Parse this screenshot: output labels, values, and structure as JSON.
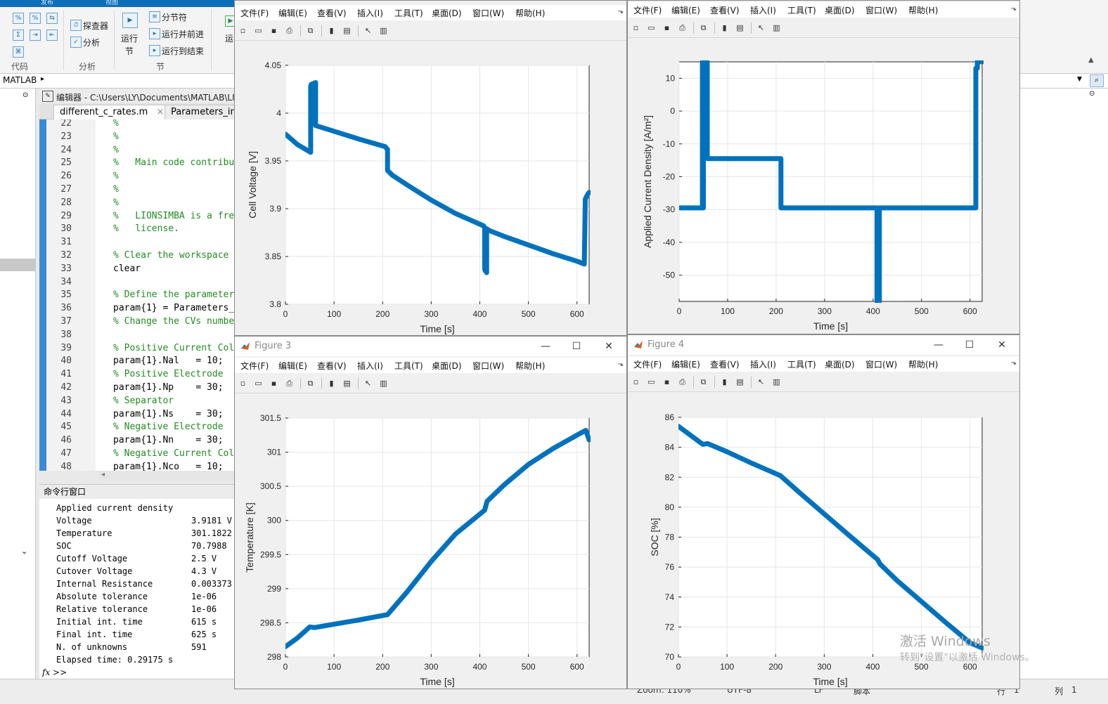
{
  "ribbon": {
    "tabs": [
      "发布",
      "视图"
    ],
    "buttons": {
      "explorer": "探查器",
      "analyze": "分析",
      "run_section_top": "运行",
      "run_section_bottom": "节",
      "section_break": "分节符",
      "run_and_advance": "运行并前进",
      "run_to_end": "运行到结束",
      "run_partial": "运"
    },
    "sections": {
      "code": "代码",
      "analyze": "分析",
      "section": "节"
    }
  },
  "address": {
    "path": "MATLAB"
  },
  "editor": {
    "title": "编辑器 - C:\\Users\\LY\\Documents\\MATLAB\\LI",
    "tabs": [
      {
        "label": "different_c_rates.m",
        "close": "×"
      },
      {
        "label": "Parameters_ini"
      }
    ],
    "lines": [
      {
        "n": "22",
        "t": "%",
        "type": "c"
      },
      {
        "n": "23",
        "t": "%",
        "type": "c"
      },
      {
        "n": "24",
        "t": "%",
        "type": "c"
      },
      {
        "n": "25",
        "t": "%   Main code contribu",
        "type": "c"
      },
      {
        "n": "26",
        "t": "%",
        "type": "c"
      },
      {
        "n": "27",
        "t": "%",
        "type": "c"
      },
      {
        "n": "28",
        "t": "%",
        "type": "c"
      },
      {
        "n": "29",
        "t": "%   LIONSIMBA is a fre",
        "type": "c"
      },
      {
        "n": "30",
        "t": "%   license.",
        "type": "c"
      },
      {
        "n": "31",
        "t": "",
        "type": "k"
      },
      {
        "n": "32",
        "t": "% Clear the workspace",
        "type": "c"
      },
      {
        "n": "33",
        "t": "clear",
        "type": "k"
      },
      {
        "n": "34",
        "t": "",
        "type": "k"
      },
      {
        "n": "35",
        "t": "% Define the parameter",
        "type": "c"
      },
      {
        "n": "36",
        "t": "param{1} = Parameters_",
        "type": "k"
      },
      {
        "n": "37",
        "t": "% Change the CVs numbe",
        "type": "c"
      },
      {
        "n": "38",
        "t": "",
        "type": "k"
      },
      {
        "n": "39",
        "t": "% Positive Current Col",
        "type": "c"
      },
      {
        "n": "40",
        "t": "param{1}.Nal   = 10;",
        "type": "k"
      },
      {
        "n": "41",
        "t": "% Positive Electrode",
        "type": "c"
      },
      {
        "n": "42",
        "t": "param{1}.Np    = 30;",
        "type": "k"
      },
      {
        "n": "43",
        "t": "% Separator",
        "type": "c"
      },
      {
        "n": "44",
        "t": "param{1}.Ns    = 30;",
        "type": "k"
      },
      {
        "n": "45",
        "t": "% Negative Electrode",
        "type": "c"
      },
      {
        "n": "46",
        "t": "param{1}.Nn    = 30;",
        "type": "k"
      },
      {
        "n": "47",
        "t": "% Negative Current Col",
        "type": "c"
      },
      {
        "n": "48",
        "t": "param{1}.Nco   = 10;",
        "type": "k"
      }
    ]
  },
  "command_window": {
    "title": "命令行窗口",
    "header": "Applied current density",
    "rows": [
      {
        "k": "Voltage",
        "v": "3.9181 V"
      },
      {
        "k": "Temperature",
        "v": "301.1822"
      },
      {
        "k": "SOC",
        "v": "70.7988"
      },
      {
        "k": "Cutoff Voltage",
        "v": "2.5 V"
      },
      {
        "k": "Cutover Voltage",
        "v": "4.3 V"
      },
      {
        "k": "Internal Resistance",
        "v": "0.003373"
      },
      {
        "k": "Absolute tolerance",
        "v": "1e-06"
      },
      {
        "k": "Relative tolerance",
        "v": "1e-06"
      },
      {
        "k": "Initial int. time",
        "v": "615 s"
      },
      {
        "k": "Final int. time",
        "v": "625 s"
      },
      {
        "k": "N. of unknowns",
        "v": "591"
      }
    ],
    "elapsed": "Elapsed time: 0.29175 s",
    "prompt": "fx >>"
  },
  "statusbar": {
    "zoom": "Zoom: 110%",
    "encoding": "UTF-8",
    "eol": "LF",
    "type": "脚本",
    "row_label": "行",
    "row": "1",
    "col_label": "列",
    "col": "1"
  },
  "figure_menu": [
    "文件(F)",
    "编辑(E)",
    "查看(V)",
    "插入(I)",
    "工具(T)",
    "桌面(D)",
    "窗口(W)",
    "帮助(H)"
  ],
  "window_buttons": {
    "minimize": "—",
    "maximize": "☐",
    "close": "✕"
  },
  "figures": [
    {
      "title": "",
      "has_titlebar": false
    },
    {
      "title": "",
      "has_titlebar": false
    },
    {
      "title": "Figure 3",
      "has_titlebar": true
    },
    {
      "title": "Figure 4",
      "has_titlebar": true
    }
  ],
  "watermark": {
    "line1": "激活 Windows",
    "line2": "转到\"设置\"以激活 Windows。"
  },
  "colors": {
    "line": "#0072bd",
    "matlab_blue": "#0d6fb8"
  },
  "chart_data": [
    {
      "type": "line",
      "xlabel": "Time [s]",
      "ylabel": "Cell Voltage [V]",
      "xlim": [
        0,
        625
      ],
      "ylim": [
        3.8,
        4.05
      ],
      "xticks": [
        0,
        100,
        200,
        300,
        400,
        500,
        600
      ],
      "yticks": [
        3.8,
        3.85,
        3.9,
        3.95,
        4,
        4.05
      ],
      "grid": true,
      "series": [
        {
          "x": [
            0,
            25,
            52,
            52,
            53,
            62,
            62,
            100,
            150,
            205,
            210,
            210,
            220,
            250,
            300,
            350,
            408,
            410,
            410,
            411,
            411,
            412,
            414,
            414,
            420,
            450,
            500,
            550,
            600,
            615,
            617,
            622,
            625
          ],
          "y": [
            3.978,
            3.967,
            3.959,
            4.028,
            4.03,
            4.032,
            3.987,
            3.981,
            3.973,
            3.965,
            3.962,
            3.94,
            3.935,
            3.925,
            3.909,
            3.895,
            3.882,
            3.88,
            3.837,
            3.835,
            3.877,
            3.879,
            3.833,
            3.879,
            3.877,
            3.871,
            3.862,
            3.853,
            3.845,
            3.842,
            3.91,
            3.915,
            3.917
          ]
        }
      ]
    },
    {
      "type": "line",
      "xlabel": "Time [s]",
      "ylabel": "Applied Current Density [A/m²]",
      "xlim": [
        0,
        625
      ],
      "ylim": [
        -58,
        15
      ],
      "xticks": [
        0,
        100,
        200,
        300,
        400,
        500,
        600
      ],
      "yticks": [
        -50,
        -40,
        -30,
        -20,
        -10,
        0,
        10
      ],
      "grid": true,
      "series": [
        {
          "x": [
            0,
            48,
            48,
            48,
            50,
            50,
            58,
            58,
            60,
            60,
            210,
            210,
            408,
            408,
            413,
            413,
            612,
            612,
            615,
            615,
            625
          ],
          "y": [
            -29.5,
            -29.5,
            15,
            -29.5,
            -29.5,
            15,
            15,
            -14.5,
            -14.5,
            -14.5,
            -14.5,
            -29.5,
            -29.5,
            -58,
            -58,
            -29.5,
            -29.5,
            13,
            13,
            15,
            15
          ]
        }
      ]
    },
    {
      "type": "line",
      "xlabel": "Time [s]",
      "ylabel": "Temperature [K]",
      "xlim": [
        0,
        625
      ],
      "ylim": [
        298,
        301.5
      ],
      "xticks": [
        0,
        100,
        200,
        300,
        400,
        500,
        600
      ],
      "yticks": [
        298,
        298.5,
        299,
        299.5,
        300,
        300.5,
        301,
        301.5
      ],
      "grid": true,
      "series": [
        {
          "x": [
            0,
            25,
            50,
            60,
            100,
            150,
            210,
            250,
            300,
            350,
            410,
            415,
            450,
            500,
            550,
            600,
            618,
            625
          ],
          "y": [
            298.15,
            298.28,
            298.44,
            298.43,
            298.48,
            298.54,
            298.62,
            298.95,
            299.4,
            299.8,
            300.15,
            300.28,
            300.52,
            300.82,
            301.05,
            301.25,
            301.32,
            301.18
          ]
        }
      ]
    },
    {
      "type": "line",
      "xlabel": "Time [s]",
      "ylabel": "SOC [%]",
      "xlim": [
        0,
        625
      ],
      "ylim": [
        70,
        86
      ],
      "xticks": [
        0,
        100,
        200,
        300,
        400,
        500,
        600
      ],
      "yticks": [
        70,
        72,
        74,
        76,
        78,
        80,
        82,
        84,
        86
      ],
      "grid": true,
      "series": [
        {
          "x": [
            0,
            25,
            50,
            60,
            100,
            150,
            210,
            250,
            300,
            350,
            410,
            415,
            450,
            500,
            550,
            600,
            625
          ],
          "y": [
            85.4,
            84.8,
            84.2,
            84.25,
            83.7,
            82.95,
            82.1,
            80.95,
            79.55,
            78.15,
            76.5,
            76.2,
            75.1,
            73.7,
            72.3,
            70.95,
            70.6
          ]
        }
      ]
    }
  ]
}
